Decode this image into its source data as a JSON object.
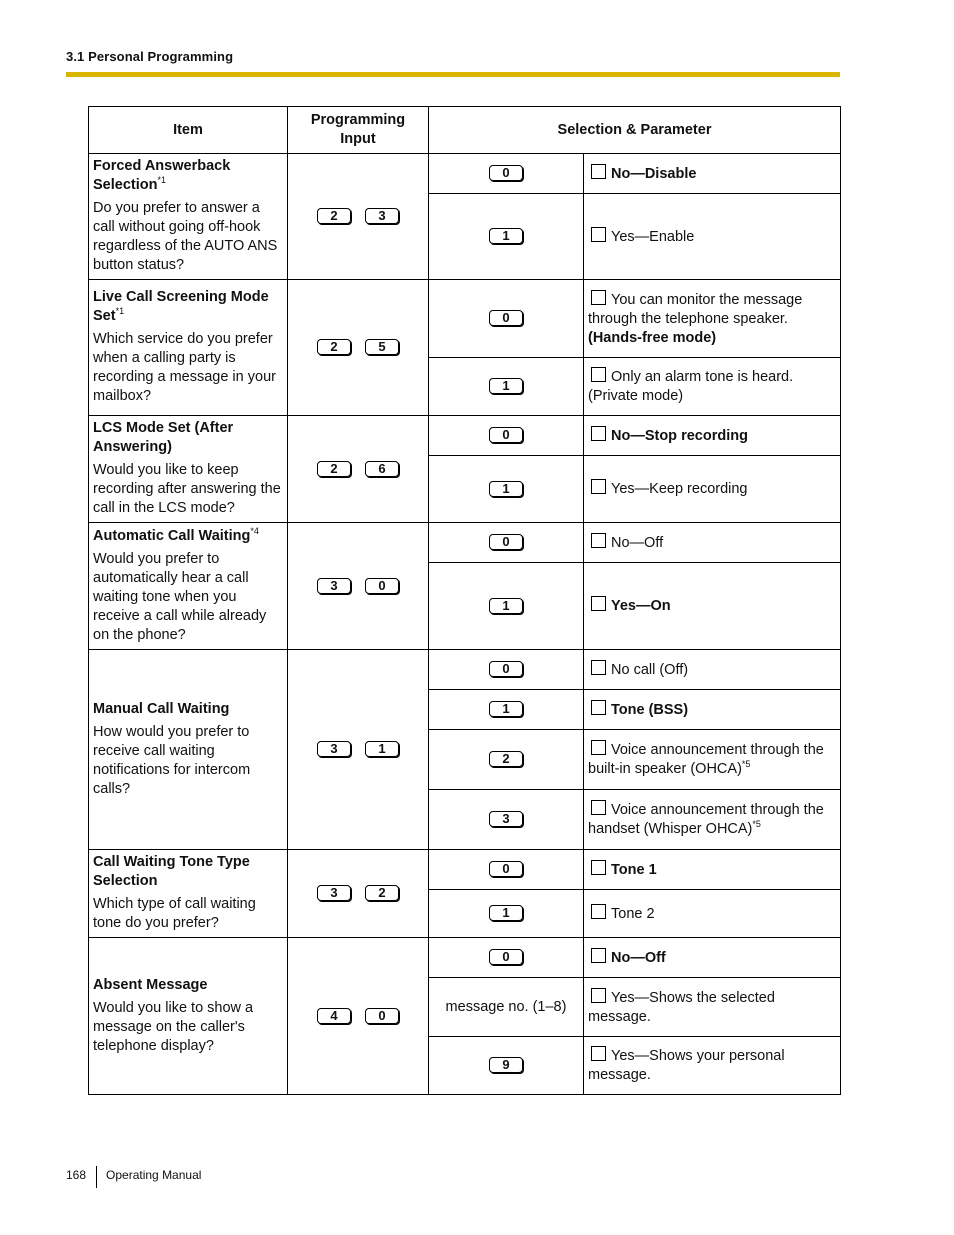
{
  "header": {
    "section_title": "3.1 Personal Programming",
    "rule_color": "#d9b500"
  },
  "table": {
    "columns": {
      "item": "Item",
      "input": "Programming Input",
      "selection": "Selection & Parameter"
    },
    "rows": [
      {
        "title": "Forced Answerback Selection",
        "title_note": "*1",
        "description": "Do you prefer to answer a call without going off-hook regardless of the AUTO ANS button status?",
        "keys": [
          "2",
          "3"
        ],
        "options": [
          {
            "key": "0",
            "label": "No—Disable",
            "bold": true
          },
          {
            "key": "1",
            "label": "Yes—Enable",
            "bold": false
          }
        ]
      },
      {
        "title": "Live Call Screening Mode Set",
        "title_note": "*1",
        "description": "Which service do you prefer when a calling party is recording a message in your mailbox?",
        "keys": [
          "2",
          "5"
        ],
        "options": [
          {
            "key": "0",
            "label": "You can monitor the message through the telephone speaker.",
            "label_suffix": "(Hands-free mode)",
            "suffix_bold": true
          },
          {
            "key": "1",
            "label": "Only an alarm tone is heard.",
            "label_suffix": "(Private mode)",
            "suffix_bold": false
          }
        ]
      },
      {
        "title": "LCS Mode Set (After Answering)",
        "title_note": "",
        "description": "Would you like to keep recording after answering the call in the LCS mode?",
        "keys": [
          "2",
          "6"
        ],
        "options": [
          {
            "key": "0",
            "label": "No—Stop recording",
            "bold": true
          },
          {
            "key": "1",
            "label": "Yes—Keep recording",
            "bold": false
          }
        ]
      },
      {
        "title": "Automatic Call Waiting",
        "title_note": "*4",
        "description": "Would you prefer to automatically hear a call waiting tone when you receive a call while already on the phone?",
        "keys": [
          "3",
          "0"
        ],
        "options": [
          {
            "key": "0",
            "label": "No—Off",
            "bold": false
          },
          {
            "key": "1",
            "label": "Yes—On",
            "bold": true
          }
        ]
      },
      {
        "title": "Manual Call Waiting",
        "title_note": "",
        "description": "How would you prefer to receive call waiting notifications for intercom calls?",
        "keys": [
          "3",
          "1"
        ],
        "options": [
          {
            "key": "0",
            "label": "No call (Off)",
            "bold": false
          },
          {
            "key": "1",
            "label": "Tone (BSS)",
            "bold": true
          },
          {
            "key": "2",
            "label": "Voice announcement through the built-in speaker (OHCA)",
            "note": "*5",
            "bold": false
          },
          {
            "key": "3",
            "label": "Voice announcement through the handset (Whisper OHCA)",
            "note": "*5",
            "bold": false
          }
        ]
      },
      {
        "title": "Call Waiting Tone Type Selection",
        "title_note": "",
        "description": "Which type of call waiting tone do you prefer?",
        "keys": [
          "3",
          "2"
        ],
        "options": [
          {
            "key": "0",
            "label": "Tone 1",
            "bold": true
          },
          {
            "key": "1",
            "label": "Tone 2",
            "bold": false
          }
        ]
      },
      {
        "title": "Absent Message",
        "title_note": "",
        "description": "Would you like to show a message on the caller's telephone display?",
        "keys": [
          "4",
          "0"
        ],
        "options": [
          {
            "key": "0",
            "label": "No—Off",
            "bold": true
          },
          {
            "selection_text": "message no. (1–8)",
            "label": "Yes—Shows the selected message.",
            "bold": false
          },
          {
            "key": "9",
            "label": "Yes—Shows your personal message.",
            "bold": false
          }
        ]
      }
    ]
  },
  "footer": {
    "page_number": "168",
    "manual_title": "Operating Manual"
  }
}
